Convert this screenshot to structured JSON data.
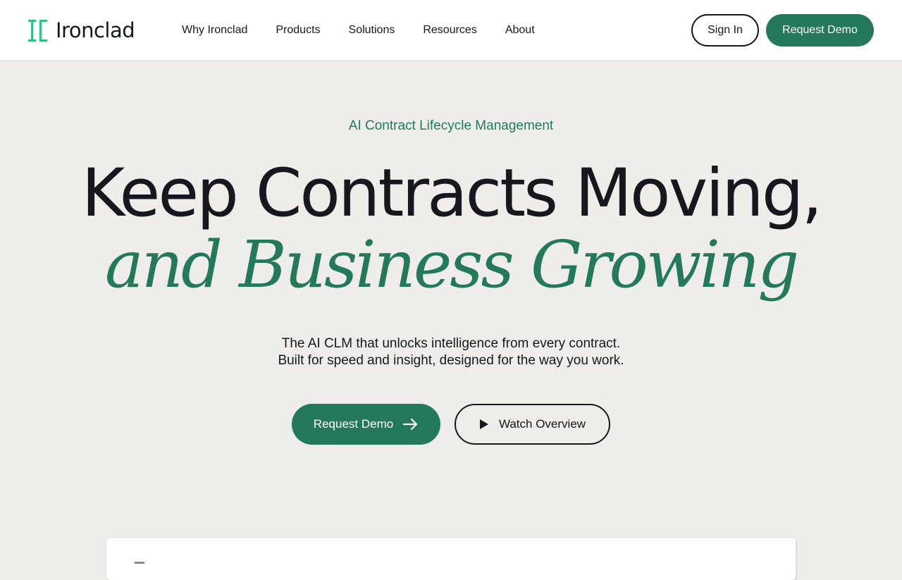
{
  "brand": {
    "name": "Ironclad",
    "logo_icon": "ironclad-logo-icon",
    "logo_color": "#2ec28a"
  },
  "nav": {
    "items": [
      {
        "label": "Why Ironclad"
      },
      {
        "label": "Products"
      },
      {
        "label": "Solutions"
      },
      {
        "label": "Resources"
      },
      {
        "label": "About"
      }
    ],
    "sign_in_label": "Sign In",
    "request_demo_label": "Request Demo"
  },
  "hero": {
    "eyebrow": "AI Contract Lifecycle Management",
    "headline_line1": "Keep Contracts Moving,",
    "headline_line2": "and Business Growing",
    "subtext_line1": "The AI CLM that unlocks intelligence from every contract.",
    "subtext_line2": "Built for speed and insight, designed for the way you work.",
    "primary_cta": {
      "label": "Request Demo",
      "icon": "arrow-right-icon"
    },
    "secondary_cta": {
      "label": "Watch Overview",
      "icon": "play-icon"
    }
  },
  "colors": {
    "accent": "#24795c",
    "text": "#16181d",
    "background": "#eeedea",
    "header_background": "#ffffff"
  }
}
